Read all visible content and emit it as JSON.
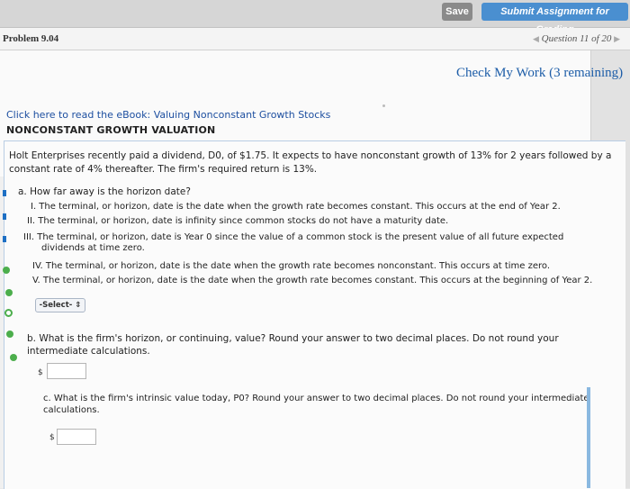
{
  "toolbar": {
    "save_label": "Save",
    "submit_label": "Submit Assignment for Grading"
  },
  "problem": {
    "title": "Problem 9.04",
    "question_nav": "Question 11 of 20"
  },
  "check_work": "Check My Work (3 remaining)",
  "ebook_link": "Click here to read the eBook: Valuing Nonconstant Growth Stocks",
  "heading": "NONCONSTANT GROWTH VALUATION",
  "intro_line1": "Holt Enterprises recently paid a dividend, D0, of $1.75. It expects to have nonconstant growth of 13% for 2 years followed by a",
  "intro_line2": "constant rate of 4% thereafter. The firm's required return is 13%.",
  "part_a": {
    "question": "a. How far away is the horizon date?",
    "options": [
      "I. The terminal, or horizon, date is the date when the growth rate becomes constant. This occurs at the end of Year 2.",
      "II. The terminal, or horizon, date is infinity since common stocks do not have a maturity date.",
      "III. The terminal, or horizon, date is Year 0 since the value of a common stock is the present value of all future expected",
      "dividends at time zero.",
      "IV. The terminal, or horizon, date is the date when the growth rate becomes nonconstant. This occurs at time zero.",
      "V. The terminal, or horizon, date is the date when the growth rate becomes constant. This occurs at the beginning of Year 2."
    ],
    "select_label": "-Select-",
    "select_arrow": "⇕"
  },
  "part_b": {
    "question": "b. What is the firm's horizon, or continuing, value? Round your answer to two decimal places. Do not round your intermediate calculations.",
    "currency": "$"
  },
  "part_c": {
    "question": "c. What is the firm's intrinsic value today, P0? Round your answer to two decimal places. Do not round your intermediate calculations.",
    "currency": "$"
  },
  "colors": {
    "link": "#1d4fa0",
    "submit_bg": "#4a8fd0",
    "save_bg": "#8a8a8a",
    "status_green": "#4cae4c"
  }
}
